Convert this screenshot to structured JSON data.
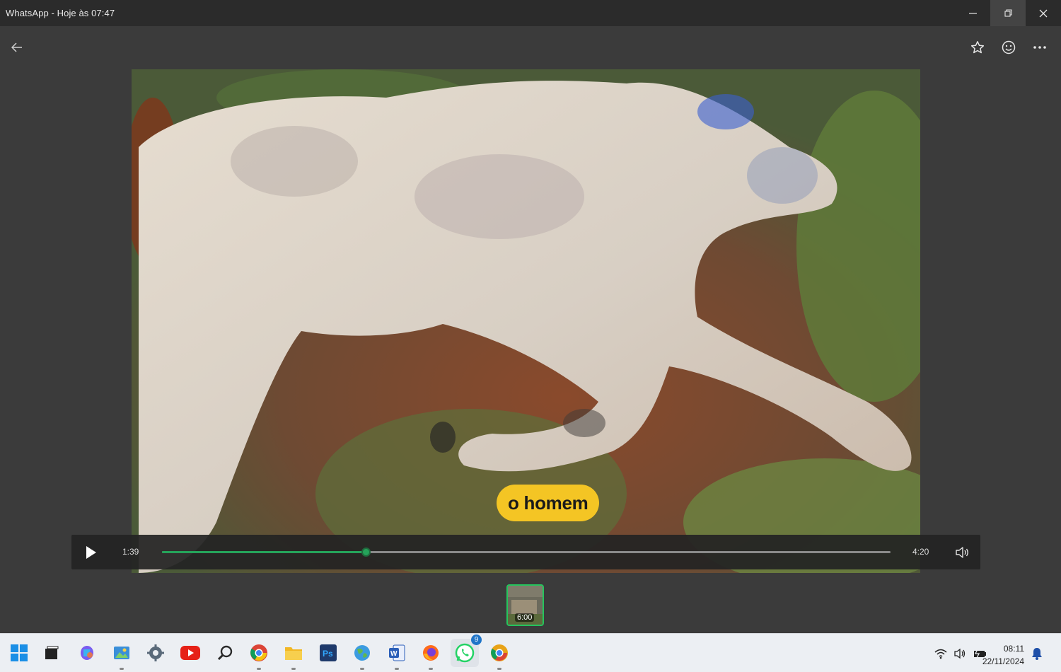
{
  "window": {
    "title": "WhatsApp - Hoje às 07:47",
    "minimize_icon": "minimize-icon",
    "restore_icon": "restore-icon",
    "close_icon": "close-icon"
  },
  "toolbar": {
    "back_icon": "arrow-left-icon",
    "star_icon": "star-icon",
    "react_icon": "emoji-icon",
    "more_icon": "more-horizontal-icon"
  },
  "video": {
    "subtitle": "o homem",
    "current_time": "1:39",
    "total_time": "4:20",
    "progress": 0.28,
    "play_icon": "play-icon",
    "volume_icon": "volume-icon"
  },
  "thumbnail": {
    "duration": "6:00"
  },
  "taskbar": {
    "apps": [
      {
        "name": "windows-start-icon",
        "color": "#1b8fe6"
      },
      {
        "name": "task-view-icon",
        "color": "#222222"
      },
      {
        "name": "copilot-icon",
        "color": "#7b5cf0"
      },
      {
        "name": "photos-icon",
        "color": "#3a8fd9"
      },
      {
        "name": "settings-icon",
        "color": "#5a6a7a"
      },
      {
        "name": "youtube-icon",
        "color": "#e62117"
      },
      {
        "name": "search-app-icon",
        "color": "#2a2a2a"
      },
      {
        "name": "chrome-icon",
        "color": "#34a853"
      },
      {
        "name": "file-explorer-icon",
        "color": "#f2b724"
      },
      {
        "name": "photoshop-icon",
        "color": "#1f3a6b"
      },
      {
        "name": "maps-icon",
        "color": "#3b9be0"
      },
      {
        "name": "word-icon",
        "color": "#2b5fb8"
      },
      {
        "name": "firefox-icon",
        "color": "#ff6b1a"
      },
      {
        "name": "whatsapp-icon",
        "color": "#25d366"
      },
      {
        "name": "chrome-canary-icon",
        "color": "#e8a317"
      }
    ],
    "whatsapp_badge": "9",
    "tray": {
      "wifi_icon": "wifi-icon",
      "volume_icon": "speaker-icon",
      "battery_icon": "battery-icon"
    },
    "clock": {
      "time": "08:11",
      "date": "22/11/2024"
    },
    "notification_icon": "bell-icon"
  },
  "colors": {
    "accent": "#25a35a",
    "subtitle_bg": "#f4c524"
  }
}
